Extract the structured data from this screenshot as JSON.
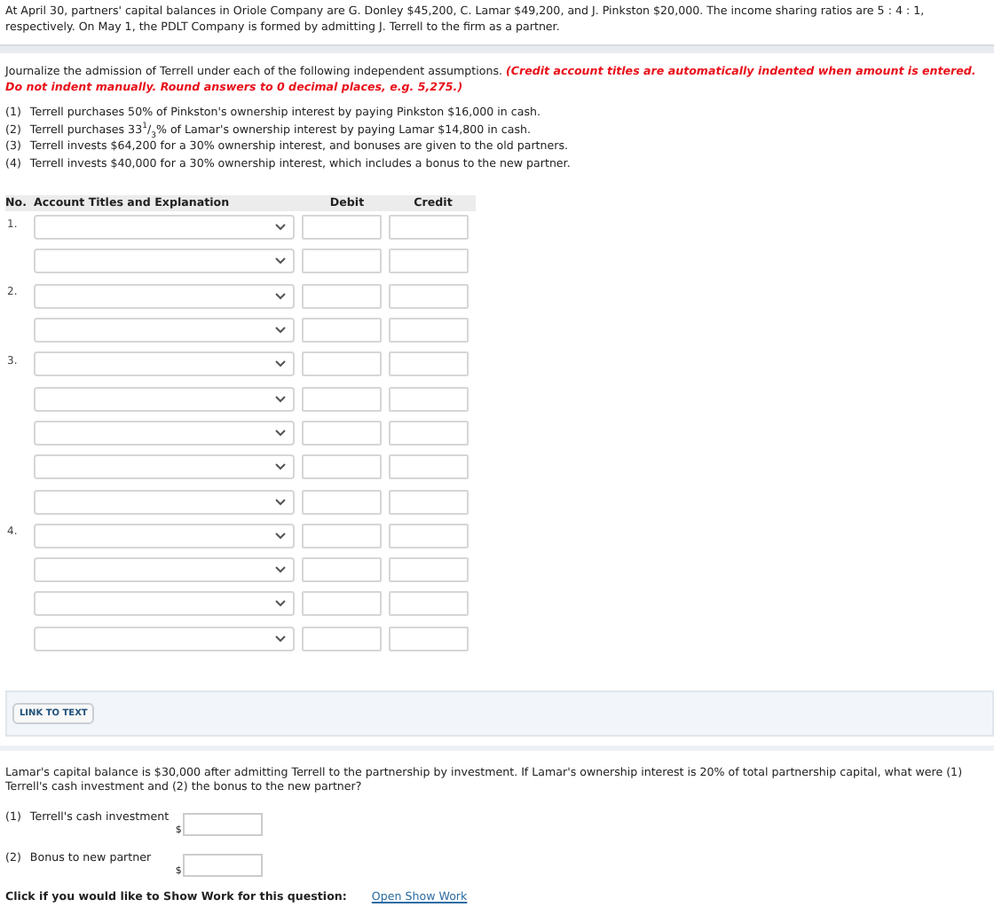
{
  "intro": "At April 30, partners' capital balances in Oriole Company are G. Donley $45,200, C. Lamar $49,200, and J. Pinkston $20,000. The income sharing ratios are 5 : 4 : 1, respectively. On May 1, the PDLT Company is formed by admitting J. Terrell to the firm as a partner.",
  "instruction": "Journalize the admission of Terrell under each of the following independent assumptions.",
  "note": "(Credit account titles are automatically indented when amount is entered. Do not indent manually. Round answers to 0 decimal places, e.g. 5,275.)",
  "assumptions": [
    {
      "number": "(1)",
      "text": "Terrell purchases 50% of Pinkston's ownership interest by paying Pinkston $16,000 in cash."
    },
    {
      "number": "(2)",
      "text": "Terrell purchases 33$^{1}$/$_{3}$% of Lamar's ownership interest by paying Lamar $14,800 in cash."
    },
    {
      "number": "(3)",
      "text": "Terrell invests $64,200 for a 30% ownership interest, and bonuses are given to the old partners."
    },
    {
      "number": "(4)",
      "text": "Terrell invests $40,000 for a 30% ownership interest, which includes a bonus to the new partner."
    }
  ],
  "journal": {
    "columns": [
      "No.",
      "Account Titles and Explanation",
      "Debit",
      "Credit"
    ],
    "entries": [
      {
        "number": "1.",
        "rows": [
          {
            "kind": "line"
          },
          {
            "kind": "line"
          }
        ]
      },
      {
        "number": "2.",
        "rows": [
          {
            "kind": "line"
          },
          {
            "kind": "line"
          }
        ]
      },
      {
        "number": "3.",
        "rows": [
          {
            "kind": "line"
          },
          {
            "kind": "line"
          },
          {
            "kind": "line"
          },
          {
            "kind": "line"
          },
          {
            "kind": "line"
          }
        ]
      },
      {
        "number": "4.",
        "rows": [
          {
            "kind": "line"
          },
          {
            "kind": "line"
          },
          {
            "kind": "line"
          },
          {
            "kind": "line"
          }
        ]
      }
    ]
  },
  "link_button": "LINK TO TEXT",
  "question": "Lamar's capital balance is $30,000 after admitting Terrell to the partnership by investment. If Lamar's ownership interest is 20% of total partnership capital, what were (1) Terrell's cash investment and (2) the bonus to the new partner?",
  "answers": [
    {
      "number": "(1)",
      "label": "Terrell's cash investment",
      "currency": "$"
    },
    {
      "number": "(2)",
      "label": "Bonus to new partner",
      "currency": "$"
    }
  ],
  "show_work": {
    "prompt": "Click if you would like to Show Work for this question:",
    "link": "Open Show Work"
  }
}
